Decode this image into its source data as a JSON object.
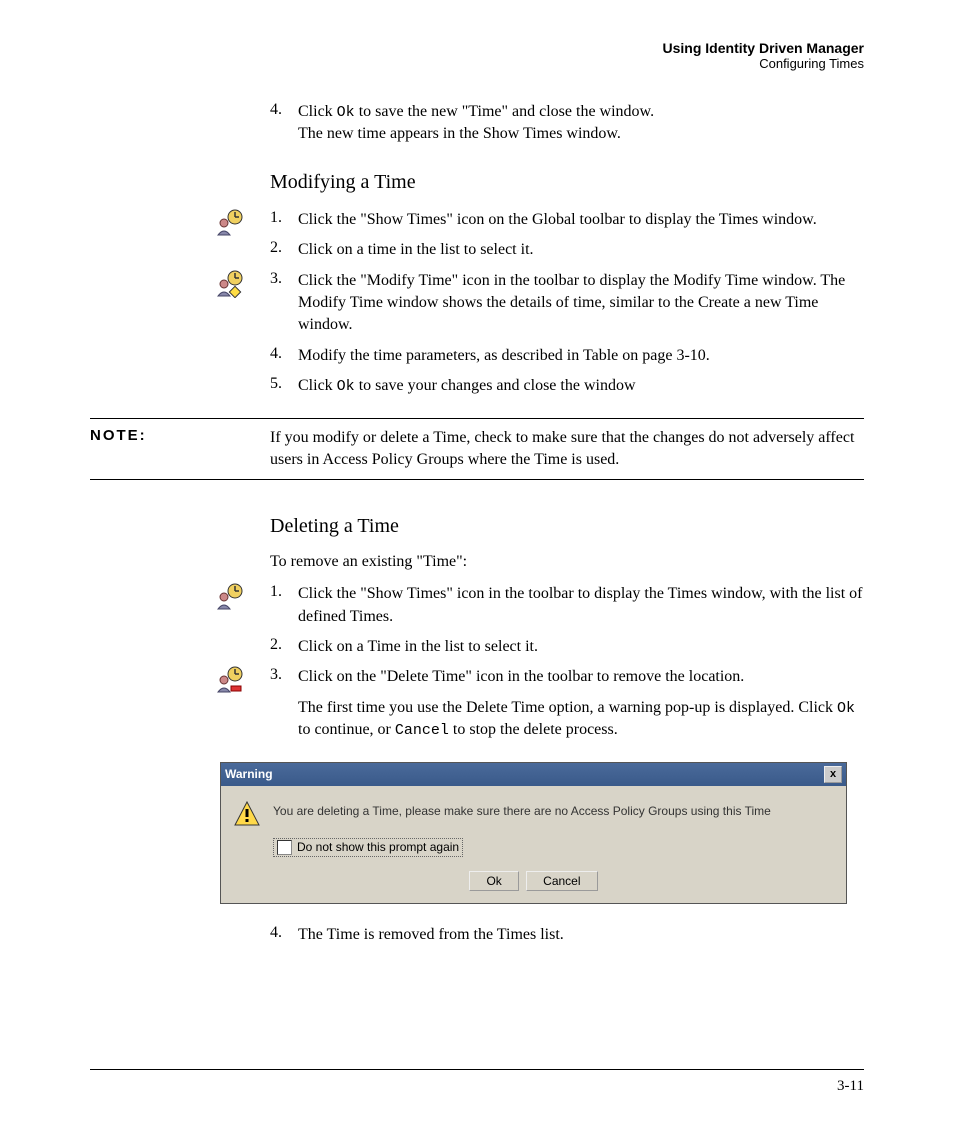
{
  "header": {
    "title": "Using Identity Driven Manager",
    "subtitle": "Configuring Times"
  },
  "top_steps": [
    {
      "num": "4.",
      "text_a": "Click ",
      "mono": "Ok",
      "text_b": " to save the new \"Time\" and close the window.",
      "extra": "The new time appears in the Show Times window."
    }
  ],
  "section_modify": {
    "heading": "Modifying a Time",
    "steps": [
      {
        "num": "1.",
        "text": "Click the \"Show Times\" icon on the Global toolbar to display the Times window.",
        "icon": "show-times"
      },
      {
        "num": "2.",
        "text": "Click on a time in the list to select it."
      },
      {
        "num": "3.",
        "text": "Click the \"Modify Time\" icon in the toolbar to display the Modify Time window. The Modify Time window shows the details of time, similar to the Create a new Time window.",
        "icon": "modify-time"
      },
      {
        "num": "4.",
        "text": "Modify the time parameters, as described in Table  on page 3-10."
      },
      {
        "num": "5.",
        "text_a": "Click ",
        "mono": "Ok",
        "text_b": " to save your changes and close the window"
      }
    ]
  },
  "note": {
    "label": "NOTE:",
    "text": "If you modify or delete a Time, check to make sure that the changes do not adversely affect users in Access Policy Groups where the Time is used."
  },
  "section_delete": {
    "heading": "Deleting a Time",
    "intro": "To remove an existing \"Time\":",
    "steps": [
      {
        "num": "1.",
        "text": "Click the \"Show Times\" icon in the toolbar to display the Times window, with the list of defined Times.",
        "icon": "show-times"
      },
      {
        "num": "2.",
        "text": "Click on a Time in the list to select it."
      },
      {
        "num": "3.",
        "text": "Click on the  \"Delete Time\" icon in the toolbar to remove the location.",
        "icon": "delete-time",
        "sub_a": "The first time you use the Delete Time option, a warning pop-up is displayed. Click ",
        "sub_mono1": "Ok",
        "sub_b": " to continue, or ",
        "sub_mono2": "Cancel",
        "sub_c": " to stop the delete process."
      }
    ],
    "after_dialog_step": {
      "num": "4.",
      "text": "The Time is removed from the Times list."
    }
  },
  "dialog": {
    "title": "Warning",
    "close": "x",
    "message": "You are deleting a Time, please make sure there are no Access Policy Groups using this Time",
    "checkbox_label": "Do not show this prompt again",
    "ok": "Ok",
    "cancel": "Cancel"
  },
  "footer": {
    "page": "3-11"
  }
}
